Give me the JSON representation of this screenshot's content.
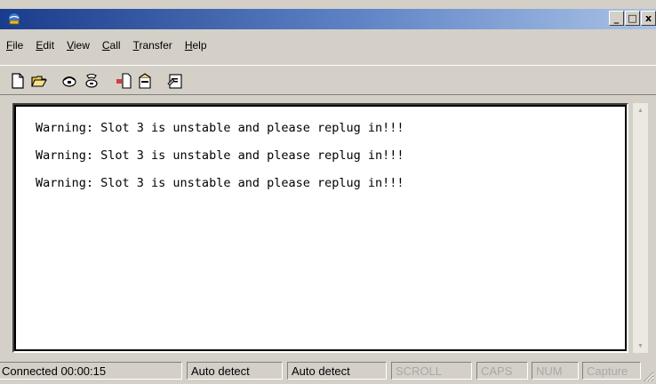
{
  "window": {
    "controls": {
      "minimize": "_",
      "maximize": "□",
      "close": "x"
    }
  },
  "menu": {
    "items": [
      {
        "accel": "F",
        "rest": "ile"
      },
      {
        "accel": "E",
        "rest": "dit"
      },
      {
        "accel": "V",
        "rest": "iew"
      },
      {
        "accel": "C",
        "rest": "all"
      },
      {
        "accel": "T",
        "rest": "ransfer"
      },
      {
        "accel": "H",
        "rest": "elp"
      }
    ]
  },
  "toolbar": {
    "buttons": [
      "new-icon",
      "open-icon",
      "connect-icon",
      "disconnect-icon",
      "send-icon",
      "receive-icon",
      "properties-icon"
    ]
  },
  "terminal": {
    "lines": [
      "Warning: Slot 3 is unstable and please replug in!!!",
      "Warning: Slot 3 is unstable and please replug in!!!",
      "Warning: Slot 3 is unstable and please replug in!!!"
    ]
  },
  "status": {
    "connected": "Connected 00:00:15",
    "detect1": "Auto detect",
    "detect2": "Auto detect",
    "scroll": "SCROLL",
    "caps": "CAPS",
    "num": "NUM",
    "capture": "Capture"
  },
  "colors": {
    "titlebar_start": "#1a3c8c",
    "titlebar_end": "#a9c2e6",
    "chrome": "#d4d0c8"
  }
}
